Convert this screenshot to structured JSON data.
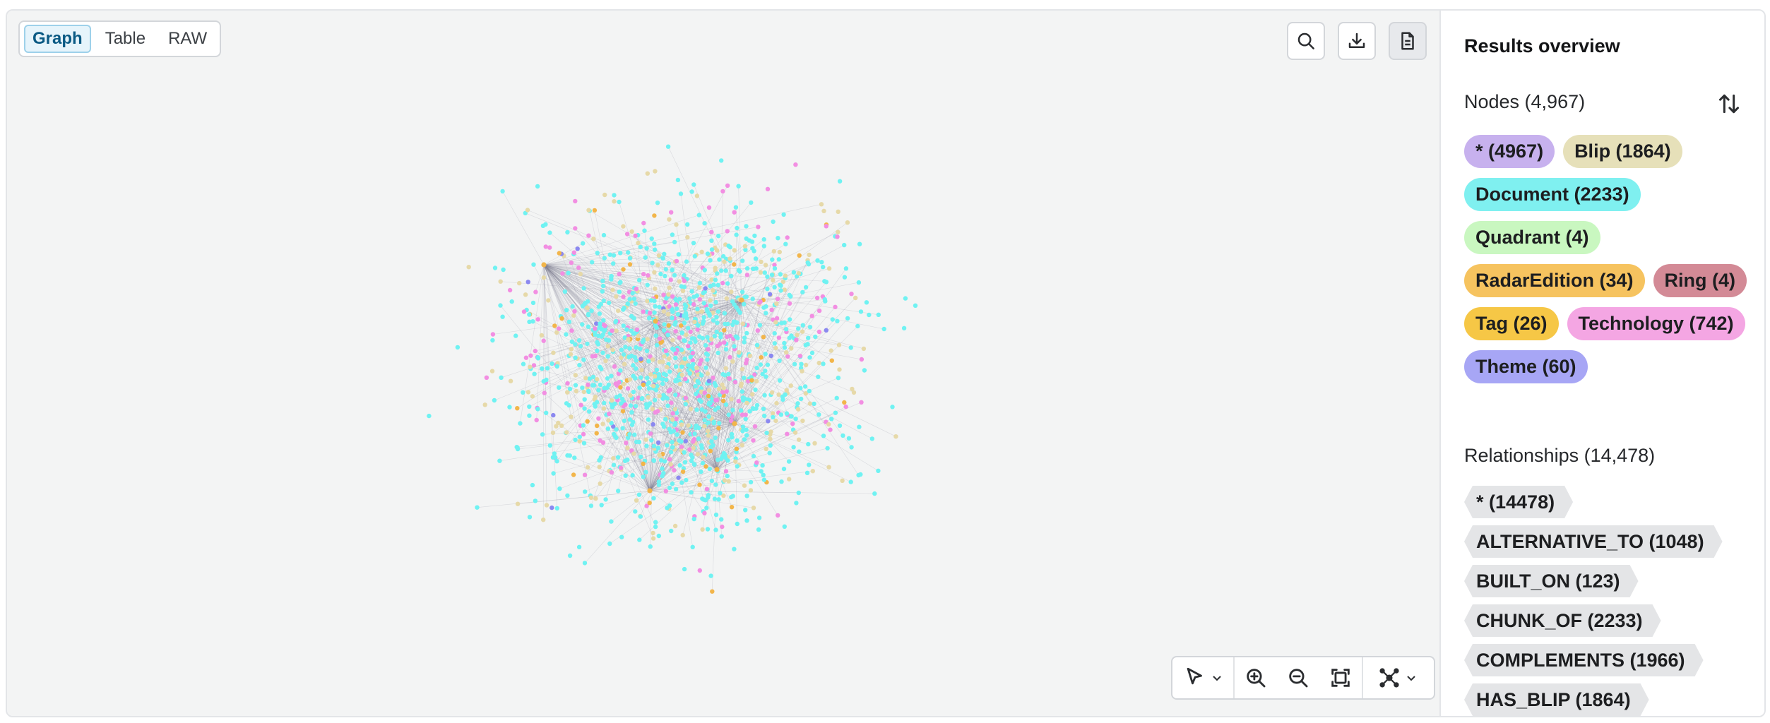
{
  "view_toggle": {
    "graph": "Graph",
    "table": "Table",
    "raw": "RAW",
    "active": "graph"
  },
  "toolbar_icons": [
    "search-icon",
    "download-icon",
    "document-icon"
  ],
  "bottom_toolbar_icons": [
    "pointer-icon",
    "zoom-in-icon",
    "zoom-out-icon",
    "fit-to-screen-icon",
    "layout-icon"
  ],
  "results": {
    "title": "Results overview",
    "nodes_label": "Nodes (4,967)",
    "node_labels": [
      {
        "text": "* (4967)",
        "color": "#c7b1ee"
      },
      {
        "text": "Blip (1864)",
        "color": "#e6e0b9"
      },
      {
        "text": "Document (2233)",
        "color": "#7ff0f0"
      },
      {
        "text": "Quadrant (4)",
        "color": "#c9f7c0"
      },
      {
        "text": "RadarEdition (34)",
        "color": "#f6c35f"
      },
      {
        "text": "Ring (4)",
        "color": "#d38a96"
      },
      {
        "text": "Tag (26)",
        "color": "#f6c746"
      },
      {
        "text": "Technology (742)",
        "color": "#f4a6e3"
      },
      {
        "text": "Theme (60)",
        "color": "#a7a6f5"
      }
    ],
    "relationships_label": "Relationships (14,478)",
    "relationship_types": [
      "* (14478)",
      "ALTERNATIVE_TO (1048)",
      "BUILT_ON (123)",
      "CHUNK_OF (2233)",
      "COMPLEMENTS (1966)",
      "HAS_BLIP (1864)"
    ]
  },
  "graph_colors": {
    "document": "#6ff2f2",
    "technology": "#f28ee2",
    "blip": "#e6d9a8",
    "radar": "#f2b54a",
    "theme": "#8b88f0",
    "edge": "#7f7f92"
  }
}
